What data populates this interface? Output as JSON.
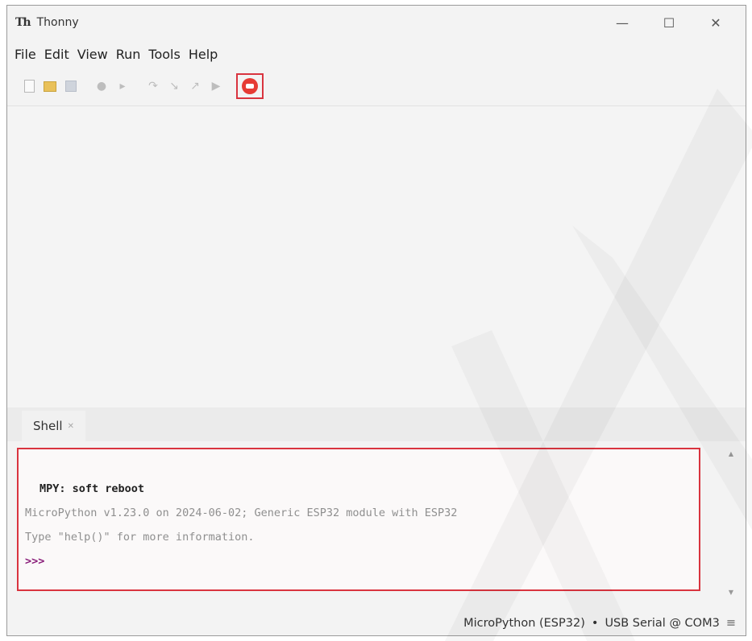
{
  "window": {
    "logo": "Th",
    "title": "Thonny",
    "controls": {
      "minimize": "—",
      "maximize": "☐",
      "close": "✕"
    }
  },
  "menu": [
    "File",
    "Edit",
    "View",
    "Run",
    "Tools",
    "Help"
  ],
  "toolbar": {
    "icons": [
      "new-file",
      "open-file",
      "save-file",
      "run",
      "debug",
      "step-over",
      "step-into",
      "step-out",
      "resume",
      "stop"
    ],
    "highlighted": "stop"
  },
  "shell": {
    "tab_label": "Shell",
    "tab_close": "✕",
    "lines": {
      "reboot": "MPY: soft reboot",
      "banner": "MicroPython v1.23.0 on 2024-06-02; Generic ESP32 module with ESP32",
      "help": "Type \"help()\" for more information.",
      "prompt": ">>>"
    }
  },
  "status": {
    "interpreter": "MicroPython (ESP32)",
    "bullet": "•",
    "port": "USB Serial @ COM3",
    "menu_icon": "≡"
  },
  "colors": {
    "highlight_border": "#d9343f",
    "stop_icon": "#e63b34",
    "prompt": "#8a1e7a"
  }
}
